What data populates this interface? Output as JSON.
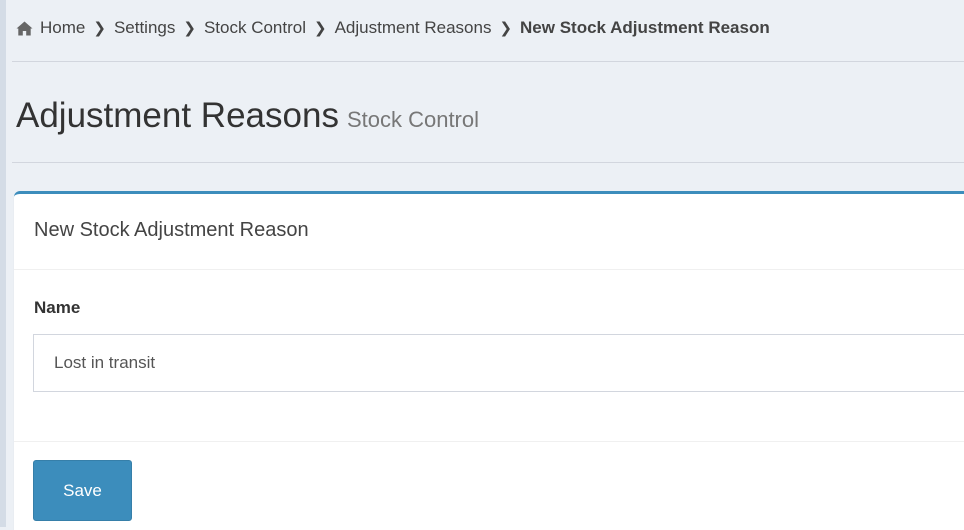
{
  "breadcrumb": {
    "items": [
      {
        "label": "Home",
        "icon": "home-icon"
      },
      {
        "label": "Settings"
      },
      {
        "label": "Stock Control"
      },
      {
        "label": "Adjustment Reasons"
      },
      {
        "label": "New Stock Adjustment Reason",
        "active": true
      }
    ],
    "separator_icon": "chevron-right-icon"
  },
  "page_header": {
    "title": "Adjustment Reasons",
    "subtitle": "Stock Control"
  },
  "form_box": {
    "title": "New Stock Adjustment Reason",
    "fields": {
      "name": {
        "label": "Name",
        "value": "Lost in transit",
        "placeholder": ""
      }
    },
    "save_label": "Save"
  },
  "colors": {
    "primary": "#3c8dbc",
    "background": "#ecf0f5",
    "box_background": "#ffffff",
    "border": "#d2d6de"
  }
}
